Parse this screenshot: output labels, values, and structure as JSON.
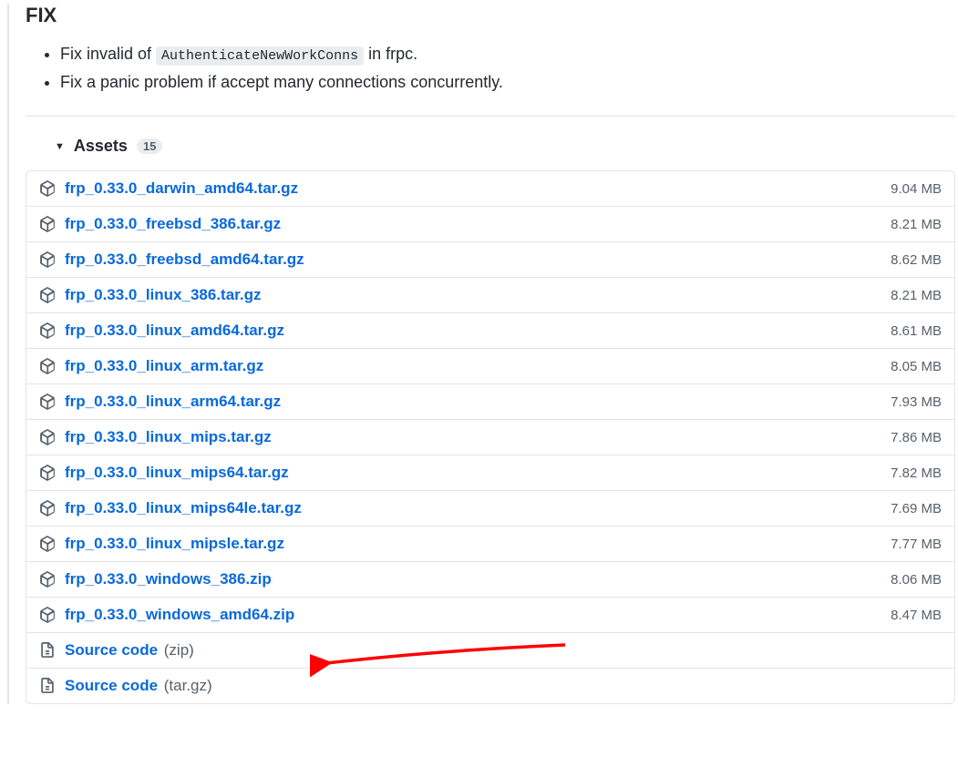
{
  "section_heading": "FIX",
  "bullets": [
    {
      "prefix": "Fix invalid of ",
      "code": "AuthenticateNewWorkConns",
      "suffix": " in frpc."
    },
    {
      "prefix": "Fix a panic problem if accept many connections concurrently.",
      "code": "",
      "suffix": ""
    }
  ],
  "assets": {
    "label": "Assets",
    "count": "15",
    "items": [
      {
        "name": "frp_0.33.0_darwin_amd64.tar.gz",
        "size": "9.04 MB",
        "kind": "pkg"
      },
      {
        "name": "frp_0.33.0_freebsd_386.tar.gz",
        "size": "8.21 MB",
        "kind": "pkg"
      },
      {
        "name": "frp_0.33.0_freebsd_amd64.tar.gz",
        "size": "8.62 MB",
        "kind": "pkg"
      },
      {
        "name": "frp_0.33.0_linux_386.tar.gz",
        "size": "8.21 MB",
        "kind": "pkg"
      },
      {
        "name": "frp_0.33.0_linux_amd64.tar.gz",
        "size": "8.61 MB",
        "kind": "pkg"
      },
      {
        "name": "frp_0.33.0_linux_arm.tar.gz",
        "size": "8.05 MB",
        "kind": "pkg"
      },
      {
        "name": "frp_0.33.0_linux_arm64.tar.gz",
        "size": "7.93 MB",
        "kind": "pkg"
      },
      {
        "name": "frp_0.33.0_linux_mips.tar.gz",
        "size": "7.86 MB",
        "kind": "pkg"
      },
      {
        "name": "frp_0.33.0_linux_mips64.tar.gz",
        "size": "7.82 MB",
        "kind": "pkg"
      },
      {
        "name": "frp_0.33.0_linux_mips64le.tar.gz",
        "size": "7.69 MB",
        "kind": "pkg"
      },
      {
        "name": "frp_0.33.0_linux_mipsle.tar.gz",
        "size": "7.77 MB",
        "kind": "pkg"
      },
      {
        "name": "frp_0.33.0_windows_386.zip",
        "size": "8.06 MB",
        "kind": "pkg"
      },
      {
        "name": "frp_0.33.0_windows_amd64.zip",
        "size": "8.47 MB",
        "kind": "pkg"
      },
      {
        "name": "Source code",
        "ext": "(zip)",
        "size": "",
        "kind": "src"
      },
      {
        "name": "Source code",
        "ext": "(tar.gz)",
        "size": "",
        "kind": "src"
      }
    ]
  },
  "annotation": {
    "arrow_color": "#ff0000",
    "target_index": 12
  }
}
